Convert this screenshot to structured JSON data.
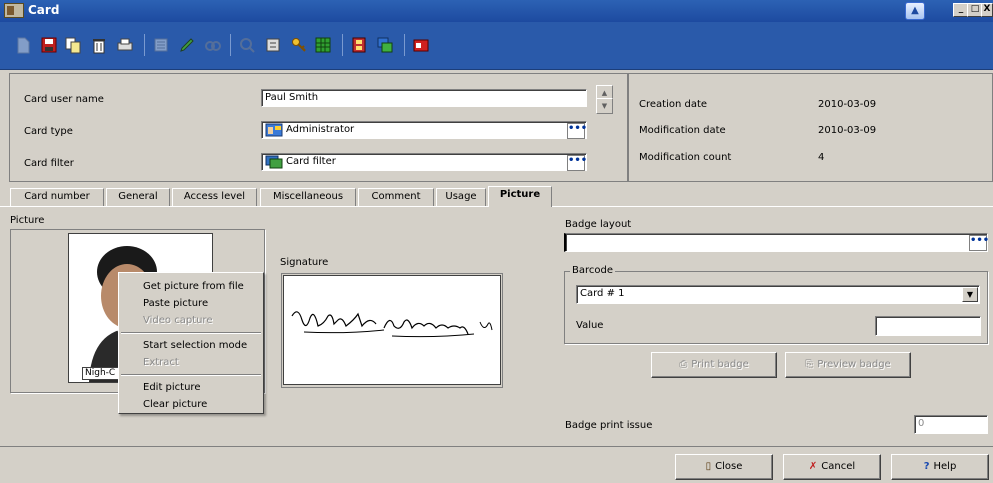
{
  "window": {
    "title": "Card",
    "controls": [
      "_",
      "□",
      "X"
    ]
  },
  "toolbar": {
    "icons": [
      "new-icon",
      "save-icon",
      "copy-icon",
      "delete-icon",
      "print-icon",
      "list-icon",
      "edit-icon",
      "find-icon",
      "search-icon",
      "properties-icon",
      "key-icon",
      "grid-icon",
      "film-icon",
      "duplicate-icon",
      "card-icon"
    ]
  },
  "header": {
    "card_user_name_label": "Card user name",
    "card_user_name_value": "Paul Smith",
    "card_type_label": "Card type",
    "card_type_value": "Administrator",
    "card_filter_label": "Card filter",
    "card_filter_value": "Card filter",
    "creation_date_label": "Creation date",
    "creation_date_value": "2010-03-09",
    "modification_date_label": "Modification date",
    "modification_date_value": "2010-03-09",
    "modification_count_label": "Modification count",
    "modification_count_value": "4",
    "browse_label": "•••"
  },
  "tabs": [
    {
      "label": "Card number"
    },
    {
      "label": "General"
    },
    {
      "label": "Access level"
    },
    {
      "label": "Miscellaneous"
    },
    {
      "label": "Comment"
    },
    {
      "label": "Usage"
    },
    {
      "label": "Picture"
    }
  ],
  "picture_tab": {
    "picture_label": "Picture",
    "picture_caption": "Nigh-C",
    "signature_label": "Signature",
    "badge_layout_label": "Badge layout",
    "badge_layout_value": "",
    "barcode_label": "Barcode",
    "barcode_value": "Card # 1",
    "value_label": "Value",
    "value_value": "",
    "print_badge_label": "Print badge",
    "preview_badge_label": "Preview badge",
    "badge_print_issue_label": "Badge print issue",
    "badge_print_issue_value": "0"
  },
  "context_menu": {
    "items": [
      {
        "label": "Get picture from file",
        "enabled": true
      },
      {
        "label": "Paste picture",
        "enabled": true
      },
      {
        "label": "Video capture",
        "enabled": false
      },
      {
        "label": "Start selection mode",
        "enabled": true
      },
      {
        "label": "Extract",
        "enabled": false
      },
      {
        "label": "Edit picture",
        "enabled": true
      },
      {
        "label": "Clear picture",
        "enabled": true
      }
    ]
  },
  "footer": {
    "close_label": "Close",
    "cancel_label": "Cancel",
    "help_label": "Help"
  }
}
